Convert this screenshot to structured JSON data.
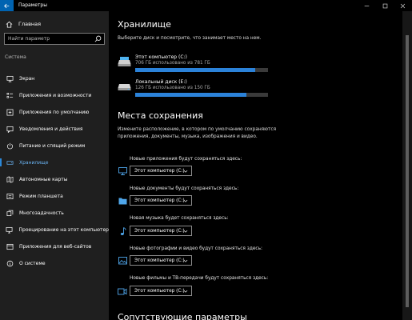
{
  "window": {
    "title": "Параметры",
    "controls": [
      "minimize-icon",
      "maximize-icon",
      "close-icon"
    ]
  },
  "sidebar": {
    "home_label": "Главная",
    "search_placeholder": "Найти параметр",
    "section_label": "Система",
    "items": [
      {
        "label": "Экран",
        "icon": "monitor-icon"
      },
      {
        "label": "Приложения и возможности",
        "icon": "apps-list-icon"
      },
      {
        "label": "Приложения по умолчанию",
        "icon": "default-apps-icon"
      },
      {
        "label": "Уведомления и действия",
        "icon": "notifications-icon"
      },
      {
        "label": "Питание и спящий режим",
        "icon": "power-icon"
      },
      {
        "label": "Хранилище",
        "icon": "storage-icon",
        "selected": true
      },
      {
        "label": "Автономные карты",
        "icon": "offline-maps-icon"
      },
      {
        "label": "Режим планшета",
        "icon": "tablet-mode-icon"
      },
      {
        "label": "Многозадачность",
        "icon": "multitasking-icon"
      },
      {
        "label": "Проецирование на этот компьютер",
        "icon": "projecting-icon"
      },
      {
        "label": "Приложения для веб-сайтов",
        "icon": "apps-for-websites-icon"
      },
      {
        "label": "О системе",
        "icon": "info-icon"
      }
    ]
  },
  "storage": {
    "title": "Хранилище",
    "description": "Выберите диск и посмотрите, что занимает место на нем.",
    "drives": [
      {
        "name": "Этот компьютер (C:)",
        "usage": "706 ГБ использовано из 781 ГБ",
        "used_fraction": 0.904
      },
      {
        "name": "Локальный диск (E:)",
        "usage": "126 ГБ использовано из 150 ГБ",
        "used_fraction": 0.84
      }
    ]
  },
  "save_locations": {
    "title": "Места сохранения",
    "description": "Измените расположение, в котором по умолчанию сохраняются приложения, документы, музыка, изображения и видео.",
    "items": [
      {
        "label": "Новые приложения будут сохраняться здесь:",
        "value": "Этот компьютер (C:)",
        "icon": "apps-monitor-icon"
      },
      {
        "label": "Новые документы будут сохраняться здесь:",
        "value": "Этот компьютер (C:)",
        "icon": "documents-folder-icon"
      },
      {
        "label": "Новая музыка будет сохраняться здесь:",
        "value": "Этот компьютер (C:)",
        "icon": "music-note-icon"
      },
      {
        "label": "Новые фотографии и видео будут сохраняться здесь:",
        "value": "Этот компьютер (C:)",
        "icon": "photos-icon"
      },
      {
        "label": "Новые фильмы и ТВ-передачи будут сохраняться здесь:",
        "value": "Этот компьютер (C:)",
        "icon": "video-camera-icon"
      }
    ]
  },
  "related": {
    "title": "Сопутствующие параметры"
  },
  "colors": {
    "accent": "#0063b1",
    "selected_text": "#69b2f0",
    "bar_fill": "#2b82d9",
    "sidebar_bg": "#1f1f1f"
  }
}
